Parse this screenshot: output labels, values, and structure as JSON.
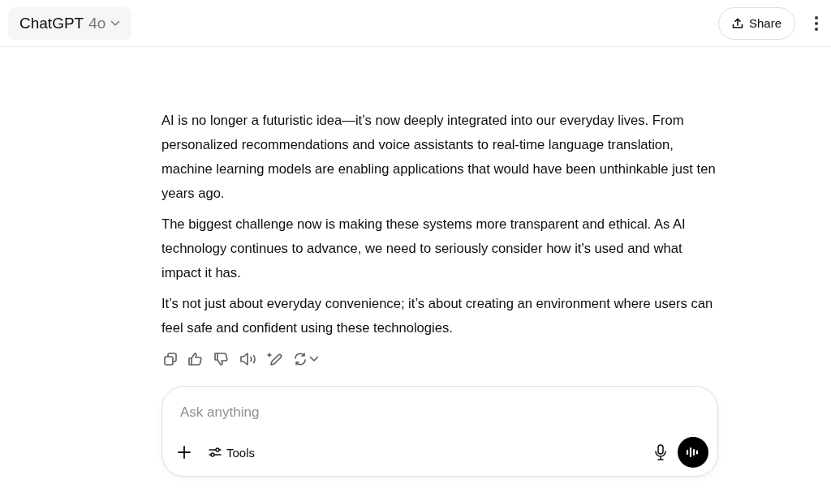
{
  "header": {
    "model_name": "ChatGPT",
    "model_version": "4o",
    "share_label": "Share"
  },
  "message": {
    "paragraphs": [
      "AI is no longer a futuristic idea—it’s now deeply integrated into our everyday lives. From personalized recommendations and voice assistants to real-time language translation, machine learning models are enabling applications that would have been unthinkable just ten years ago.",
      "The biggest challenge now is making these systems more transparent and ethical. As AI technology continues to advance, we need to seriously consider how it's used and what impact it has.",
      "It’s not just about everyday convenience; it’s about creating an environment where users can feel safe and confident using these technologies."
    ]
  },
  "composer": {
    "placeholder": "Ask anything",
    "tools_label": "Tools"
  }
}
